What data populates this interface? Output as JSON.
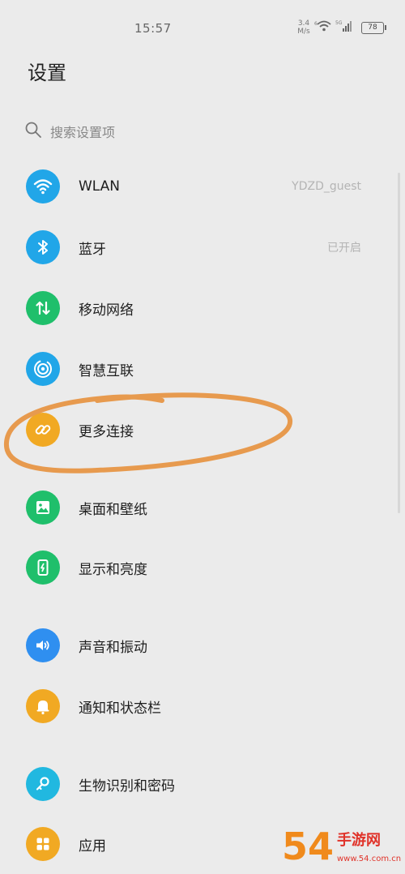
{
  "status_bar": {
    "time": "15:57",
    "net_speed_value": "3.4",
    "net_speed_unit": "M/s",
    "wifi_badge": "6",
    "cell_badge": "5G",
    "battery": "78"
  },
  "page": {
    "title": "设置"
  },
  "search": {
    "placeholder": "搜索设置项"
  },
  "items": [
    {
      "label": "WLAN",
      "value": "YDZD_guest",
      "icon": "wifi-icon",
      "color": "#21a6e8"
    },
    {
      "label": "蓝牙",
      "value": "已开启",
      "icon": "bluetooth-icon",
      "color": "#21a6e8"
    },
    {
      "label": "移动网络",
      "value": "",
      "icon": "mobile-data-icon",
      "color": "#1fbf6b"
    },
    {
      "label": "智慧互联",
      "value": "",
      "icon": "smart-connect-icon",
      "color": "#21a6e8"
    },
    {
      "label": "更多连接",
      "value": "",
      "icon": "link-icon",
      "color": "#f1a923"
    },
    {
      "label": "桌面和壁纸",
      "value": "",
      "icon": "image-icon",
      "color": "#1fbf6b"
    },
    {
      "label": "显示和亮度",
      "value": "",
      "icon": "display-icon",
      "color": "#1fbf6b"
    },
    {
      "label": "声音和振动",
      "value": "",
      "icon": "sound-icon",
      "color": "#2f8ff0"
    },
    {
      "label": "通知和状态栏",
      "value": "",
      "icon": "bell-icon",
      "color": "#f1a923"
    },
    {
      "label": "生物识别和密码",
      "value": "",
      "icon": "key-icon",
      "color": "#21b8e0"
    },
    {
      "label": "应用",
      "value": "",
      "icon": "apps-grid-icon",
      "color": "#f1a923"
    }
  ],
  "watermark": {
    "brand": "54",
    "text": "手游网",
    "domain": "www.54.com.cn"
  },
  "colors": {
    "background": "#ebebeb",
    "annotation": "#e79a4e"
  }
}
